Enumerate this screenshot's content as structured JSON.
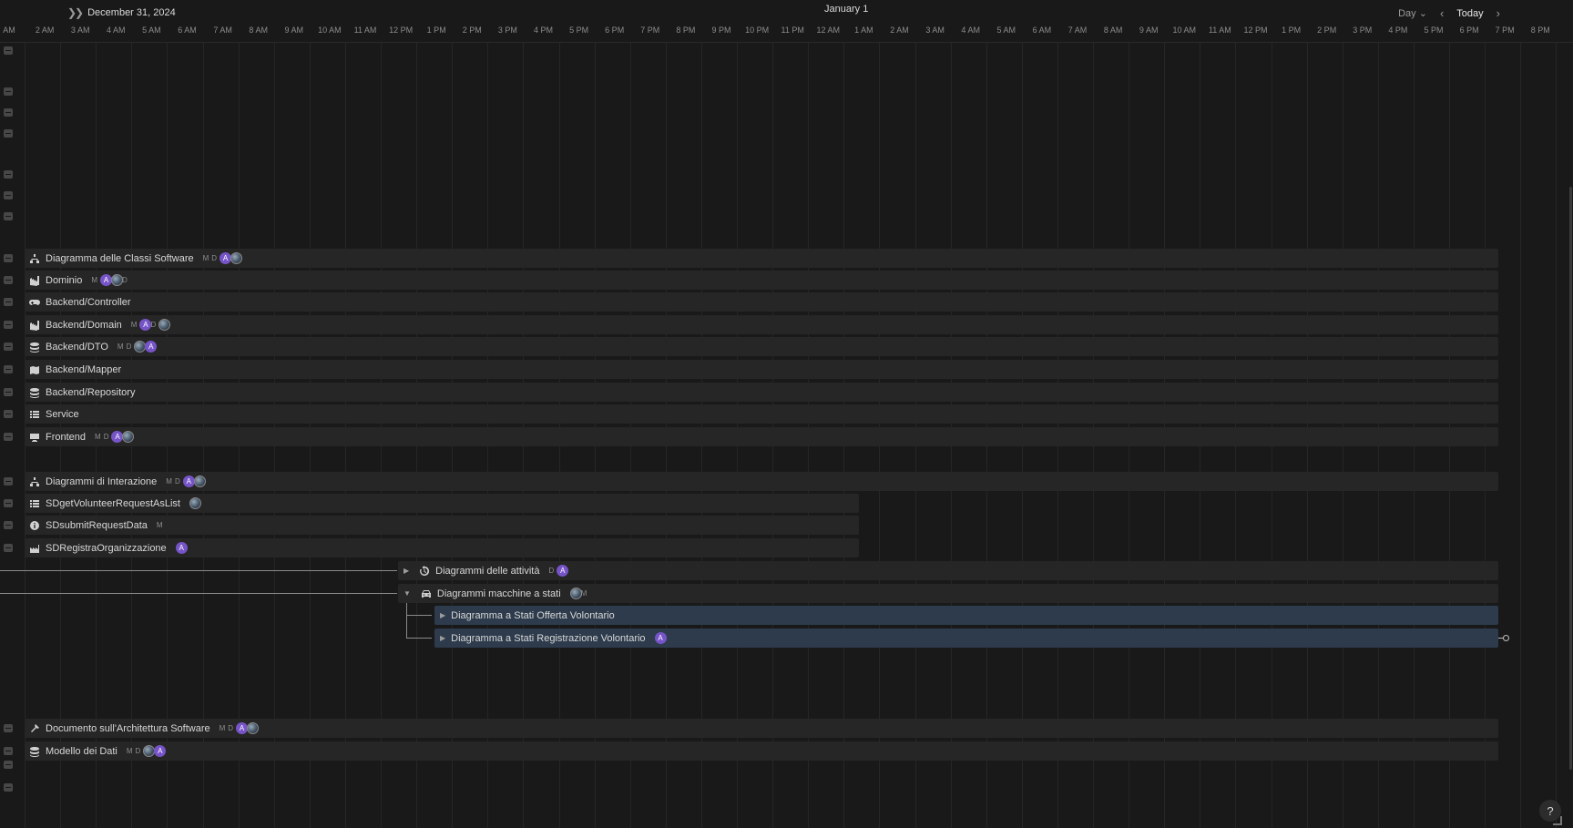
{
  "header": {
    "left_date": "December 31, 2024",
    "center_date": "January 1",
    "view_mode": "Day",
    "today_label": "Today"
  },
  "hours": [
    "AM",
    "2 AM",
    "3 AM",
    "4 AM",
    "5 AM",
    "6 AM",
    "7 AM",
    "8 AM",
    "9 AM",
    "10 AM",
    "11 AM",
    "12 PM",
    "1 PM",
    "2 PM",
    "3 PM",
    "4 PM",
    "5 PM",
    "6 PM",
    "7 PM",
    "8 PM",
    "9 PM",
    "10 PM",
    "11 PM",
    "12 AM",
    "1 AM",
    "2 AM",
    "3 AM",
    "4 AM",
    "5 AM",
    "6 AM",
    "7 AM",
    "8 AM",
    "9 AM",
    "10 AM",
    "11 AM",
    "12 PM",
    "1 PM",
    "2 PM",
    "3 PM",
    "4 PM",
    "5 PM",
    "6 PM",
    "7 PM",
    "8 PM",
    "9"
  ],
  "tasks": [
    {
      "label": "Diagramma delle Classi Software",
      "icon": "diagram-icon",
      "members": [
        "M",
        "D",
        "A",
        "img"
      ]
    },
    {
      "label": "Dominio",
      "icon": "domain-icon",
      "members": [
        "M",
        "A",
        "img",
        "D"
      ]
    },
    {
      "label": "Backend/Controller",
      "icon": "gamepad-icon",
      "members": []
    },
    {
      "label": "Backend/Domain",
      "icon": "domain-icon",
      "members": [
        "M",
        "A",
        "D",
        "img"
      ]
    },
    {
      "label": "Backend/DTO",
      "icon": "database-icon",
      "members": [
        "M",
        "D",
        "img",
        "A"
      ]
    },
    {
      "label": "Backend/Mapper",
      "icon": "map-icon",
      "members": []
    },
    {
      "label": "Backend/Repository",
      "icon": "database-icon",
      "members": []
    },
    {
      "label": "Service",
      "icon": "list-icon",
      "members": []
    },
    {
      "label": "Frontend",
      "icon": "monitor-icon",
      "members": [
        "M",
        "D",
        "A",
        "img"
      ]
    },
    {
      "label": "Diagrammi di Interazione",
      "icon": "diagram-icon",
      "members": [
        "M",
        "D",
        "A",
        "img"
      ]
    },
    {
      "label": "SDgetVolunteerRequestAsList",
      "icon": "list-icon",
      "members": [
        "img"
      ]
    },
    {
      "label": "SDsubmitRequestData",
      "icon": "info-icon",
      "members": [
        "M"
      ]
    },
    {
      "label": "SDRegistraOrganizzazione",
      "icon": "factory-icon",
      "members": [
        "A"
      ]
    },
    {
      "label": "Diagrammi delle attività",
      "icon": "history-icon",
      "members": [
        "D",
        "A"
      ]
    },
    {
      "label": "Diagrammi macchine a stati",
      "icon": "car-icon",
      "members": [
        "img",
        "M"
      ]
    },
    {
      "label": "Diagramma a Stati Offerta Volontario",
      "icon": "",
      "members": []
    },
    {
      "label": "Diagramma a Stati Registrazione Volontario",
      "icon": "",
      "members": [
        "A"
      ]
    },
    {
      "label": "Documento sull'Architettura Software",
      "icon": "hammer-icon",
      "members": [
        "M",
        "D",
        "A",
        "img"
      ]
    },
    {
      "label": "Modello dei Dati",
      "icon": "database-icon",
      "members": [
        "M",
        "D",
        "img",
        "A"
      ]
    }
  ],
  "help_label": "?"
}
